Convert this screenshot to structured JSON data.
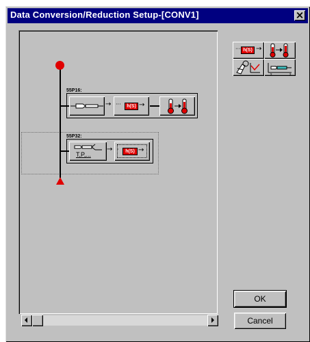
{
  "window": {
    "title": "Data Conversion/Reduction Setup-[CONV1]",
    "close_glyph": "×"
  },
  "diagram": {
    "rows": [
      {
        "label": "55P16:",
        "blocks": [
          {
            "icon": "probe-sensor-icon"
          },
          {
            "icon": "transfer-function-icon",
            "text": "h(S)"
          },
          {
            "icon": "temperature-conversion-icon"
          }
        ]
      },
      {
        "label": "55P32:",
        "blocks": [
          {
            "icon": "probe-tpq-icon",
            "text": "T,P,..."
          },
          {
            "icon": "transfer-function-icon",
            "text": "h(S)"
          }
        ]
      }
    ]
  },
  "toolbar": {
    "buttons": [
      {
        "icon": "transfer-function-icon",
        "text": "h(S)"
      },
      {
        "icon": "temperature-conversion-icon"
      },
      {
        "icon": "calibration-plot-icon"
      },
      {
        "icon": "probe-config-icon"
      }
    ]
  },
  "buttons": {
    "ok": "OK",
    "cancel": "Cancel"
  },
  "scrollbar": {
    "left_arrow": "scroll-left-icon",
    "right_arrow": "scroll-right-icon"
  },
  "colors": {
    "title_bar": "#000080",
    "dialog_bg": "#c0c0c0",
    "accent_red": "#e00000"
  }
}
